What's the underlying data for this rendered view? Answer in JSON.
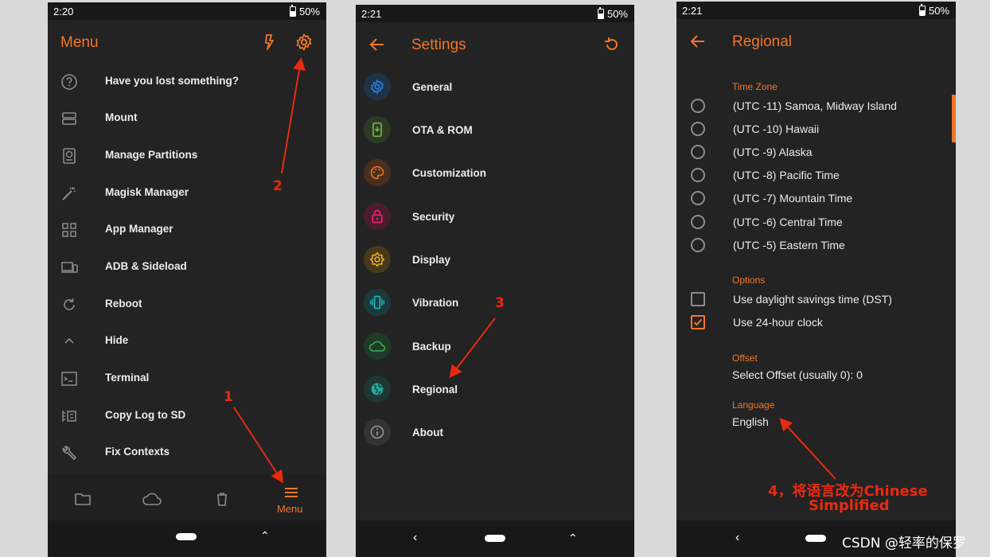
{
  "screen1": {
    "status_time": "2:20",
    "battery": "50%",
    "title": "Menu",
    "items": [
      {
        "label": "Have you lost something?",
        "icon": "help-icon"
      },
      {
        "label": "Mount",
        "icon": "storage-icon"
      },
      {
        "label": "Manage Partitions",
        "icon": "sd-card-icon"
      },
      {
        "label": "Magisk Manager",
        "icon": "magic-wand-icon"
      },
      {
        "label": "App Manager",
        "icon": "apps-icon"
      },
      {
        "label": "ADB & Sideload",
        "icon": "devices-icon"
      },
      {
        "label": "Reboot",
        "icon": "reboot-icon"
      },
      {
        "label": "Hide",
        "icon": "chevron-up-icon"
      },
      {
        "label": "Terminal",
        "icon": "terminal-icon"
      },
      {
        "label": "Copy Log to SD",
        "icon": "log-icon"
      },
      {
        "label": "Fix Contexts",
        "icon": "wrench-icon"
      }
    ],
    "bottom_menu_label": "Menu"
  },
  "screen2": {
    "status_time": "2:21",
    "battery": "50%",
    "title": "Settings",
    "items": [
      {
        "label": "General",
        "icon": "gear-icon",
        "color": "#2f7de1",
        "bg": "#1d3347"
      },
      {
        "label": "OTA & ROM",
        "icon": "phone-download-icon",
        "color": "#7cb342",
        "bg": "#2c3a25"
      },
      {
        "label": "Customization",
        "icon": "palette-icon",
        "color": "#f2762a",
        "bg": "#4a2e1e"
      },
      {
        "label": "Security",
        "icon": "lock-icon",
        "color": "#e9246a",
        "bg": "#4a1d2e"
      },
      {
        "label": "Display",
        "icon": "brightness-icon",
        "color": "#f2b41e",
        "bg": "#48391a"
      },
      {
        "label": "Vibration",
        "icon": "vibration-icon",
        "color": "#1db6b6",
        "bg": "#1c3a3b"
      },
      {
        "label": "Backup",
        "icon": "cloud-icon",
        "color": "#34a853",
        "bg": "#1f3a27"
      },
      {
        "label": "Regional",
        "icon": "globe-icon",
        "color": "#26a69a",
        "bg": "#1e3634"
      },
      {
        "label": "About",
        "icon": "info-icon",
        "color": "#9a9a9a",
        "bg": "#333333"
      }
    ]
  },
  "screen3": {
    "status_time": "2:21",
    "battery": "50%",
    "title": "Regional",
    "timezone_header": "Time Zone",
    "timezones": [
      "(UTC -11) Samoa, Midway Island",
      "(UTC -10) Hawaii",
      "(UTC -9) Alaska",
      "(UTC -8) Pacific Time",
      "(UTC -7) Mountain Time",
      "(UTC -6) Central Time",
      "(UTC -5) Eastern Time"
    ],
    "options_header": "Options",
    "options": [
      {
        "label": "Use daylight savings time (DST)",
        "checked": false
      },
      {
        "label": "Use 24-hour clock",
        "checked": true
      }
    ],
    "offset_header": "Offset",
    "offset_value": "Select Offset (usually 0): 0",
    "language_header": "Language",
    "language_value": "English"
  },
  "annotations": {
    "a1": "1",
    "a2": "2",
    "a3": "3",
    "a4_line1": "4，将语言改为Chinese",
    "a4_line2": "Simplified"
  },
  "watermark": "CSDN @轻率的保罗",
  "colors": {
    "accent": "#f2762a",
    "background": "#232323",
    "annotation": "#e82a10"
  }
}
